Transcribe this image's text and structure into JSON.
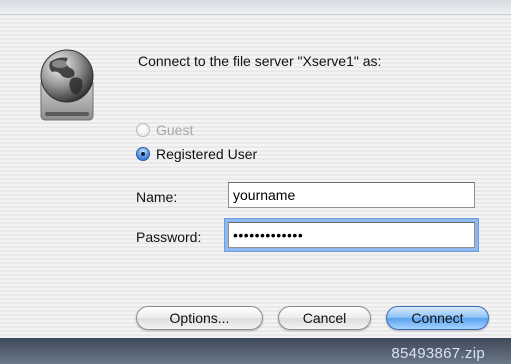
{
  "dialog": {
    "prompt": "Connect to the file server \"Xserve1\" as:",
    "guest_label": "Guest",
    "registered_label": "Registered User",
    "selected_option": "Registered User",
    "name_label": "Name:",
    "name_value": "yourname",
    "password_label": "Password:",
    "password_value": "•••••••••••••",
    "buttons": {
      "options": "Options...",
      "cancel": "Cancel",
      "connect": "Connect"
    },
    "accent_color": "#5aa3ee"
  },
  "desktop": {
    "file_label": "85493867.zip"
  },
  "icons": {
    "server": "globe-server-icon"
  }
}
